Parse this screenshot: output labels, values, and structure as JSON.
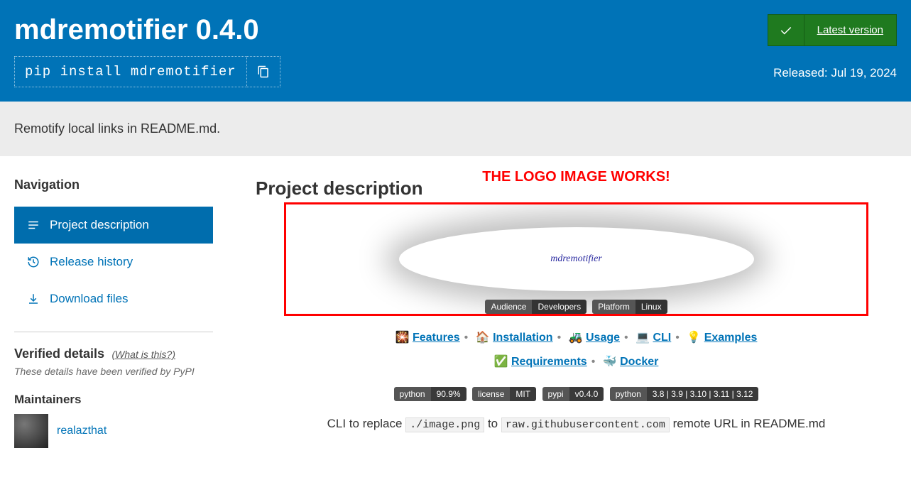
{
  "header": {
    "title": "mdremotifier 0.4.0",
    "install_cmd": "pip install mdremotifier",
    "latest_label": "Latest version",
    "released_prefix": "Released: ",
    "released_date": "Jul 19, 2024"
  },
  "summary": "Remotify local links in README.md.",
  "nav": {
    "heading": "Navigation",
    "items": [
      {
        "label": "Project description",
        "active": true
      },
      {
        "label": "Release history",
        "active": false
      },
      {
        "label": "Download files",
        "active": false
      }
    ]
  },
  "verified": {
    "heading": "Verified details",
    "what_link": "(What is this?)",
    "note": "These details have been verified by PyPI"
  },
  "maintainers": {
    "heading": "Maintainers",
    "list": [
      {
        "name": "realazthat"
      }
    ]
  },
  "content": {
    "caption": "THE LOGO IMAGE WORKS!",
    "heading": "Project description",
    "logo_text": "mdremotifier",
    "logo_badges": [
      {
        "left": "Audience",
        "right": "Developers"
      },
      {
        "left": "Platform",
        "right": "Linux"
      }
    ],
    "links_row1": [
      {
        "emoji": "🎇",
        "label": "Features"
      },
      {
        "emoji": "🏠",
        "label": "Installation"
      },
      {
        "emoji": "🚜",
        "label": "Usage"
      },
      {
        "emoji": "💻",
        "label": "CLI"
      },
      {
        "emoji": "💡",
        "label": "Examples"
      }
    ],
    "links_row2": [
      {
        "emoji": "✅",
        "label": "Requirements"
      },
      {
        "emoji": "🐳",
        "label": "Docker"
      }
    ],
    "badges": [
      {
        "left": "python",
        "right": "90.9%"
      },
      {
        "left": "license",
        "right": "MIT"
      },
      {
        "left": "pypi",
        "right": "v0.4.0"
      },
      {
        "left": "python",
        "right": "3.8 | 3.9 | 3.10 | 3.11 | 3.12"
      }
    ],
    "cli_prefix": "CLI to replace ",
    "cli_code1": "./image.png",
    "cli_mid": " to ",
    "cli_code2": "raw.githubusercontent.com",
    "cli_suffix": " remote URL in README.md"
  }
}
